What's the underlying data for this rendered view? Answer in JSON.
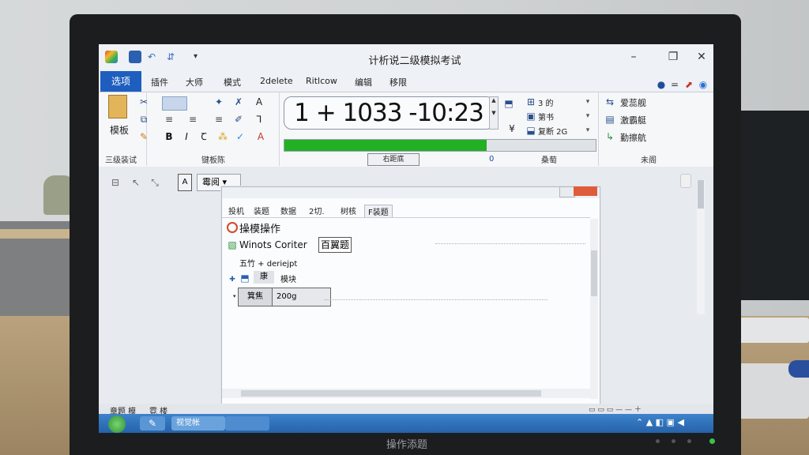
{
  "window": {
    "title": "计析说二级模拟考试"
  },
  "tabs": {
    "file": "选项",
    "items": [
      "插件",
      "大师",
      "模式",
      "2delete",
      "Ritlcow",
      "编辑",
      "移限"
    ]
  },
  "ribbon": {
    "paste_label": "模板",
    "group1_label": "三级装试",
    "group2_label": "键板陈",
    "group3_label": "桑萄",
    "group4_label": "未阁",
    "display": "1 + 1033 -10:23",
    "progress_value": 0.65,
    "mid_button": "右距底 ",
    "mid_zero": "0",
    "right_items": [
      "3 的",
      "第书",
      "复断 2G"
    ],
    "far_right_items": [
      "爱蕊舰",
      "激霸艇",
      "勤擦航"
    ]
  },
  "docbar": {
    "dropdown": "霉阅"
  },
  "dialog": {
    "tabs": [
      "投机",
      "装题",
      "数据",
      "2切.",
      "树核",
      "F装题"
    ],
    "line1": "操模操作",
    "line2": "Winots Coriter",
    "line2_box": "百翼题",
    "line3": "五竹 + deriejpt",
    "line4_a": "康",
    "line4_b": "模块",
    "field_label": "箕焦",
    "field_value": "200g"
  },
  "status": {
    "left": "章题 模",
    "mid": "霓 楼"
  },
  "taskbar": {
    "item1": "视觉帐"
  },
  "monitor_brand": "操作添题",
  "colors": {
    "file_tab": "#1e5ebf",
    "progress": "#23b024",
    "close": "#e05b3a",
    "taskbar": "#2b6bb4"
  }
}
